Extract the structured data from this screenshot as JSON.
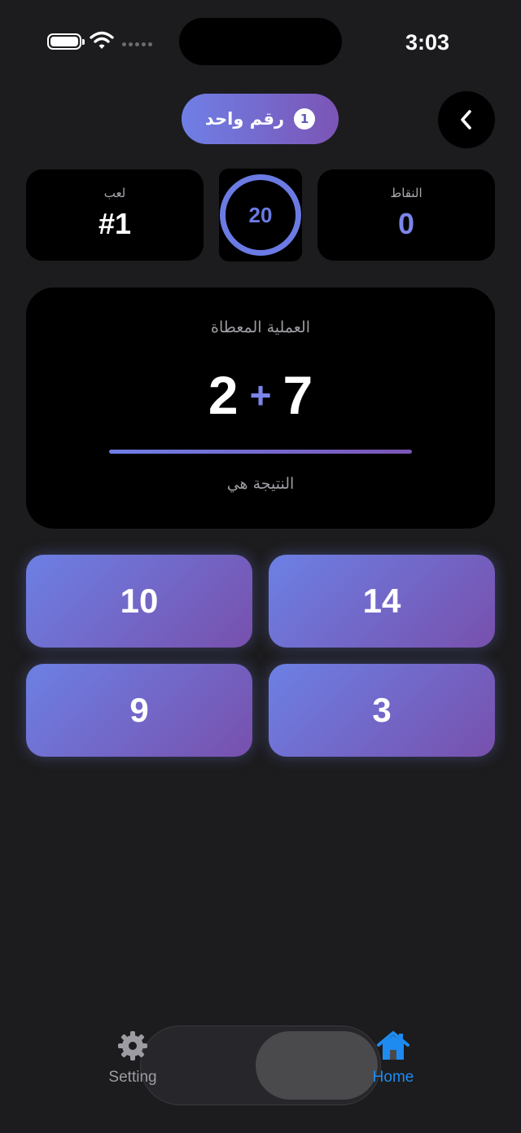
{
  "status_bar": {
    "time": "3:03",
    "icons": [
      "battery-icon",
      "wifi-icon",
      "signal-icon"
    ]
  },
  "header": {
    "mode_label": "رقم واحد",
    "mode_badge": "1",
    "back_icon": "chevron-left-icon"
  },
  "stats": {
    "game_label": "لعب",
    "game_value": "#1",
    "timer_value": "20",
    "score_label": "النقاط",
    "score_value": "0"
  },
  "question": {
    "prompt": "العملية المعطاة",
    "left_operand": "2",
    "operator": "+",
    "right_operand": "7",
    "result_label": "النتيجة هي"
  },
  "answers": [
    "10",
    "14",
    "9",
    "3"
  ],
  "tab_bar": {
    "setting_label": "Setting",
    "setting_icon": "gear-icon",
    "home_label": "Home",
    "home_icon": "home-icon",
    "active_color": "#1e8bf0"
  },
  "colors": {
    "accent_start": "#6f7fe6",
    "accent_end": "#7b55b5",
    "background": "#1c1c1e"
  }
}
